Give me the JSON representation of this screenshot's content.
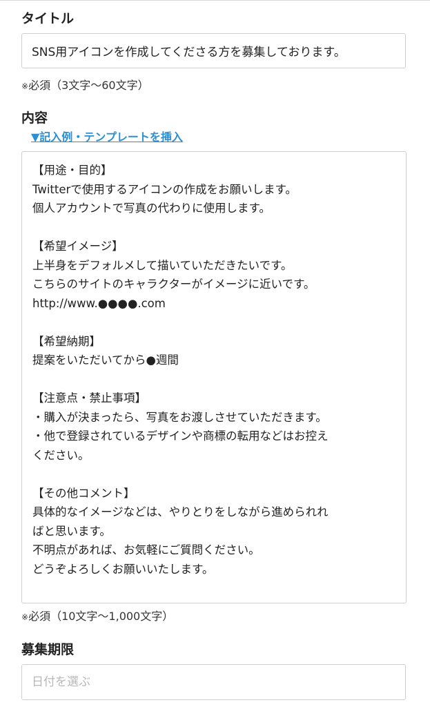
{
  "title_field": {
    "label": "タイトル",
    "value": "SNS用アイコンを作成してくださる方を募集しております。",
    "note_mark": "※",
    "note": "必須（3文字〜60文字）"
  },
  "body_field": {
    "label": "内容",
    "template_link": "▼記入例・テンプレートを挿入",
    "lines": [
      "【用途・目的】",
      "Twitterで使用するアイコンの作成をお願いします。",
      "個人アカウントで写真の代わりに使用します。",
      "",
      "【希望イメージ】",
      "上半身をデフォルメして描いていただきたいです。",
      "こちらのサイトのキャラクターがイメージに近いです。",
      "http://www.●●●●.com",
      "",
      "【希望納期】",
      "提案をいただいてから●週間",
      "",
      "【注意点・禁止事項】",
      "・購入が決まったら、写真をお渡しさせていただきます。",
      "・他で登録されているデザインや商標の転用などはお控え",
      "ください。",
      "",
      "【その他コメント】",
      "具体的なイメージなどは、やりとりをしながら進められれ",
      "ばと思います。",
      "不明点があれば、お気軽にご質問ください。",
      "どうぞよろしくお願いいたします。"
    ],
    "note_mark": "※",
    "note": "必須（10文字〜1,000文字）"
  },
  "deadline_field": {
    "label": "募集期限",
    "placeholder": "日付を選ぶ"
  }
}
